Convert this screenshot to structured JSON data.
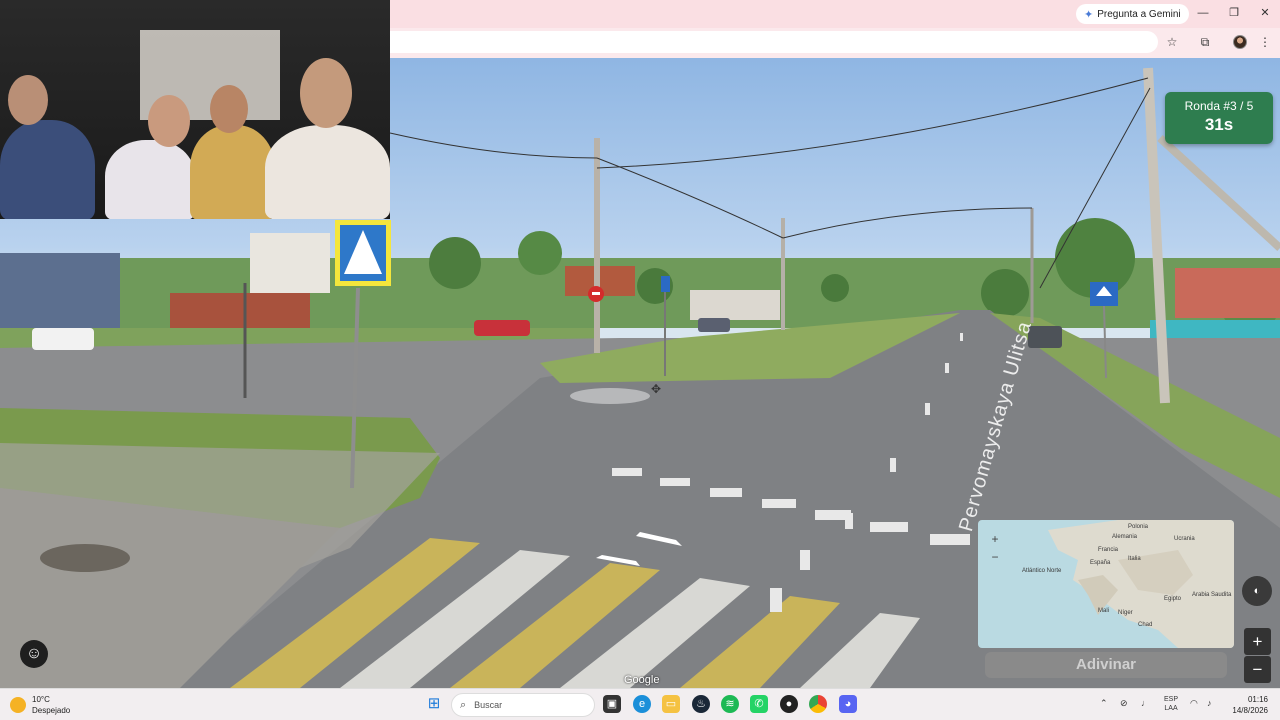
{
  "browser": {
    "gemini_button": "Pregunta a Gemini",
    "window_controls": [
      "minimize-icon",
      "restore-icon",
      "close-icon"
    ],
    "toolbar_icons": [
      "star-icon",
      "extensions-icon",
      "profile-avatar",
      "menu-icon"
    ]
  },
  "game": {
    "round_label": "Ronda #3 / 5",
    "timer": "31s",
    "guess_button": "Adivinar",
    "street_name": "Pervomayskaya Ulitsa",
    "watermark": "Google",
    "map_labels": [
      "Polonia",
      "Alemania",
      "Francia",
      "España",
      "Italia",
      "Mali",
      "Níger",
      "Egipto",
      "Chad",
      "Arabia Saudita",
      "Atlántico Norte",
      "Ucrania"
    ],
    "colors": {
      "badge": "#2e7d4f",
      "guess_disabled": "#8a8a8a"
    }
  },
  "taskbar": {
    "weather_temp": "10°C",
    "weather_desc": "Despejado",
    "search_placeholder": "Buscar",
    "apps": [
      "windows-start-icon",
      "file-explorer-icon",
      "edge-icon",
      "folder-icon",
      "steam-icon",
      "spotify-icon",
      "whatsapp-icon",
      "app-icon",
      "chrome-icon",
      "discord-icon"
    ],
    "lang_top": "ESP",
    "lang_bottom": "LAA",
    "time": "01:16",
    "date": "14/8/2026"
  }
}
